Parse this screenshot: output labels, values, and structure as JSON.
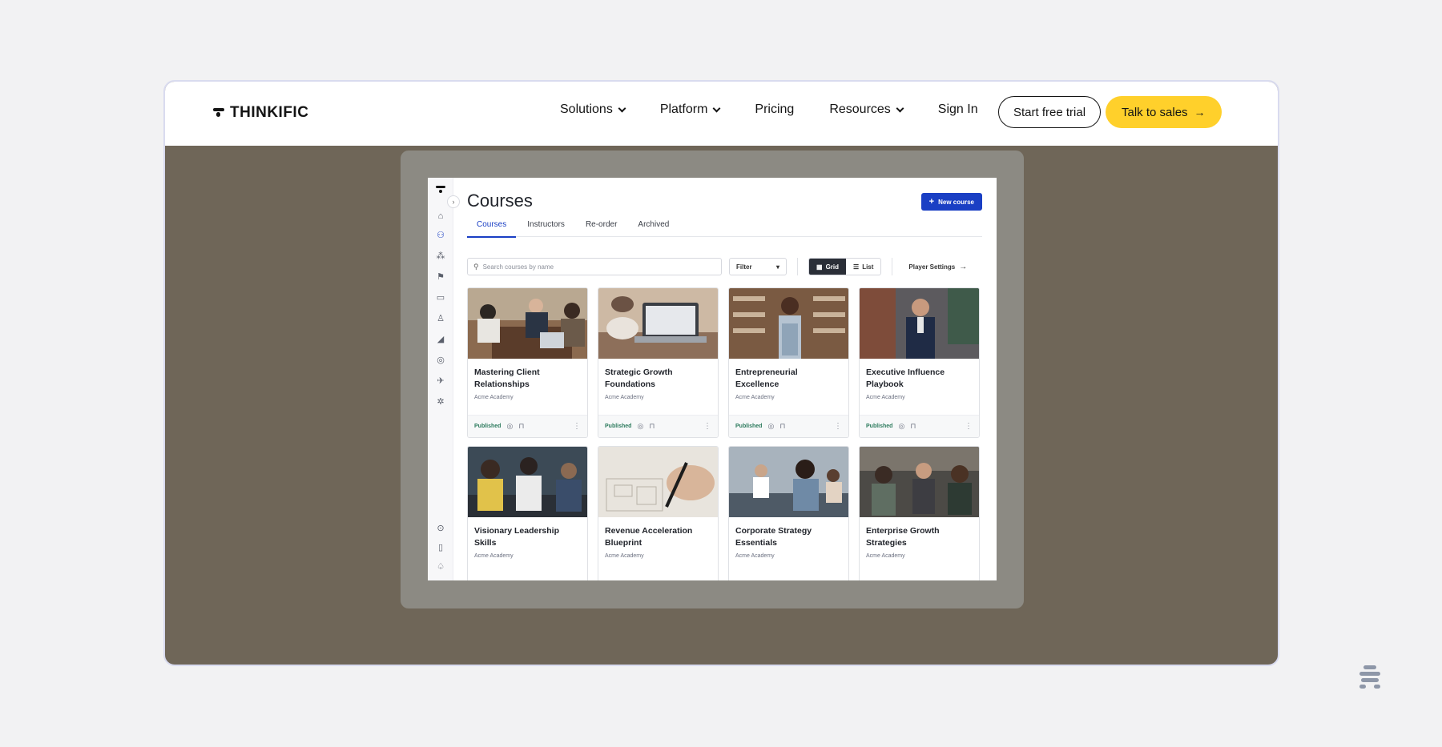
{
  "site": {
    "brand": "THINKIFIC",
    "nav": [
      {
        "label": "Solutions",
        "dropdown": true
      },
      {
        "label": "Platform",
        "dropdown": true
      },
      {
        "label": "Pricing",
        "dropdown": false
      },
      {
        "label": "Resources",
        "dropdown": true
      },
      {
        "label": "Sign In",
        "dropdown": false
      }
    ],
    "cta_trial": "Start free trial",
    "cta_sales": "Talk to sales",
    "cta_sales_arrow": "→"
  },
  "app": {
    "title": "Courses",
    "new_button": "New course",
    "new_button_icon": "+",
    "tabs": [
      {
        "label": "Courses",
        "active": true
      },
      {
        "label": "Instructors",
        "active": false
      },
      {
        "label": "Re-order",
        "active": false
      },
      {
        "label": "Archived",
        "active": false
      }
    ],
    "search_placeholder": "Search courses by name",
    "filter_label": "Filter",
    "view_grid": "Grid",
    "view_list": "List",
    "player_settings": "Player Settings",
    "cards": [
      {
        "title": "Mastering Client Relationships",
        "sub": "Acme Academy",
        "status": "Published",
        "img": "meeting-photo"
      },
      {
        "title": "Strategic Growth Foundations",
        "sub": "Acme Academy",
        "status": "Published",
        "img": "laptop-photo"
      },
      {
        "title": "Entrepreneurial Excellence",
        "sub": "Acme Academy",
        "status": "Published",
        "img": "shop-owner-photo"
      },
      {
        "title": "Executive Influence Playbook",
        "sub": "Acme Academy",
        "status": "Published",
        "img": "executive-photo"
      },
      {
        "title": "Visionary Leadership Skills",
        "sub": "Acme Academy",
        "status": "",
        "img": "team-photo"
      },
      {
        "title": "Revenue Acceleration Blueprint",
        "sub": "Acme Academy",
        "status": "",
        "img": "blueprint-photo"
      },
      {
        "title": "Corporate Strategy Essentials",
        "sub": "Acme Academy",
        "status": "",
        "img": "office-photo"
      },
      {
        "title": "Enterprise Growth Strategies",
        "sub": "Acme Academy",
        "status": "",
        "img": "workshop-photo"
      }
    ]
  },
  "colors": {
    "accent_yellow": "#ffd02b",
    "app_blue": "#1a3fc4",
    "status_green": "#2b7a5c",
    "hero_bg": "#6f6658"
  }
}
